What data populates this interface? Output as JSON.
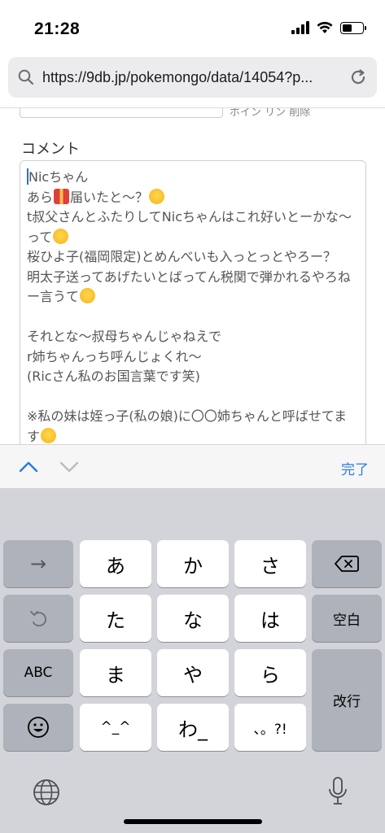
{
  "status": {
    "time": "21:28"
  },
  "browser": {
    "url": "https://9db.jp/pokemongo/data/14054?p..."
  },
  "form": {
    "top_hint": "ボイン リン 削除",
    "comment_label": "コメント",
    "comment_lines": [
      {
        "text": "Nicちゃん"
      },
      {
        "pre": "あら",
        "emoji": "gift",
        "post": "届いたと〜？",
        "emoji2": "tongue"
      },
      {
        "text": "t叔父さんとふたりしてNicちゃんはこれ好いとーかな〜"
      },
      {
        "pre": "って",
        "emoji": "heart-eyes"
      },
      {
        "text": "桜ひよ子(福岡限定)とめんべいも入っとっとやろー？"
      },
      {
        "text": "明太子送ってあげたいとばってん税関で弾かれるやろね"
      },
      {
        "pre": "ー言うて",
        "emoji": "zany"
      },
      {
        "text": ""
      },
      {
        "text": "それとな〜叔母ちゃんじゃねえで"
      },
      {
        "text": "r姉ちゃんっち呼んじょくれ〜"
      },
      {
        "text": "(Ricさん私のお国言葉です笑)"
      },
      {
        "text": ""
      },
      {
        "text": "※私の妹は姪っ子(私の娘)に〇〇姉ちゃんと呼ばせてま"
      },
      {
        "pre": "す",
        "emoji": "shush"
      }
    ]
  },
  "toolbar": {
    "done_label": "完了",
    "icons": [
      "chevron-up-icon",
      "chevron-down-icon"
    ]
  },
  "keyboard": {
    "rows": [
      [
        "→",
        "あ",
        "か",
        "さ",
        "⌫"
      ],
      [
        "↺",
        "た",
        "な",
        "は",
        "空白"
      ],
      [
        "ABC",
        "ま",
        "や",
        "ら",
        "改行"
      ],
      [
        "☺",
        "^^",
        "わ_",
        "、。?!"
      ]
    ],
    "key_labels": {
      "arrow": "→",
      "a": "あ",
      "ka": "か",
      "sa": "さ",
      "undo": "↺",
      "ta": "た",
      "na": "な",
      "ha": "は",
      "space": "空白",
      "abc": "ABC",
      "ma": "ま",
      "ya": "や",
      "ra": "ら",
      "return": "改行",
      "emoji": "☺",
      "kaomoji": "^_^",
      "wa": "わ_",
      "punct": "、。?!"
    }
  },
  "colors": {
    "accent": "#2a7ae2",
    "caret": "#2a6fdb",
    "keyboard_bg": "#d2d4d9"
  }
}
